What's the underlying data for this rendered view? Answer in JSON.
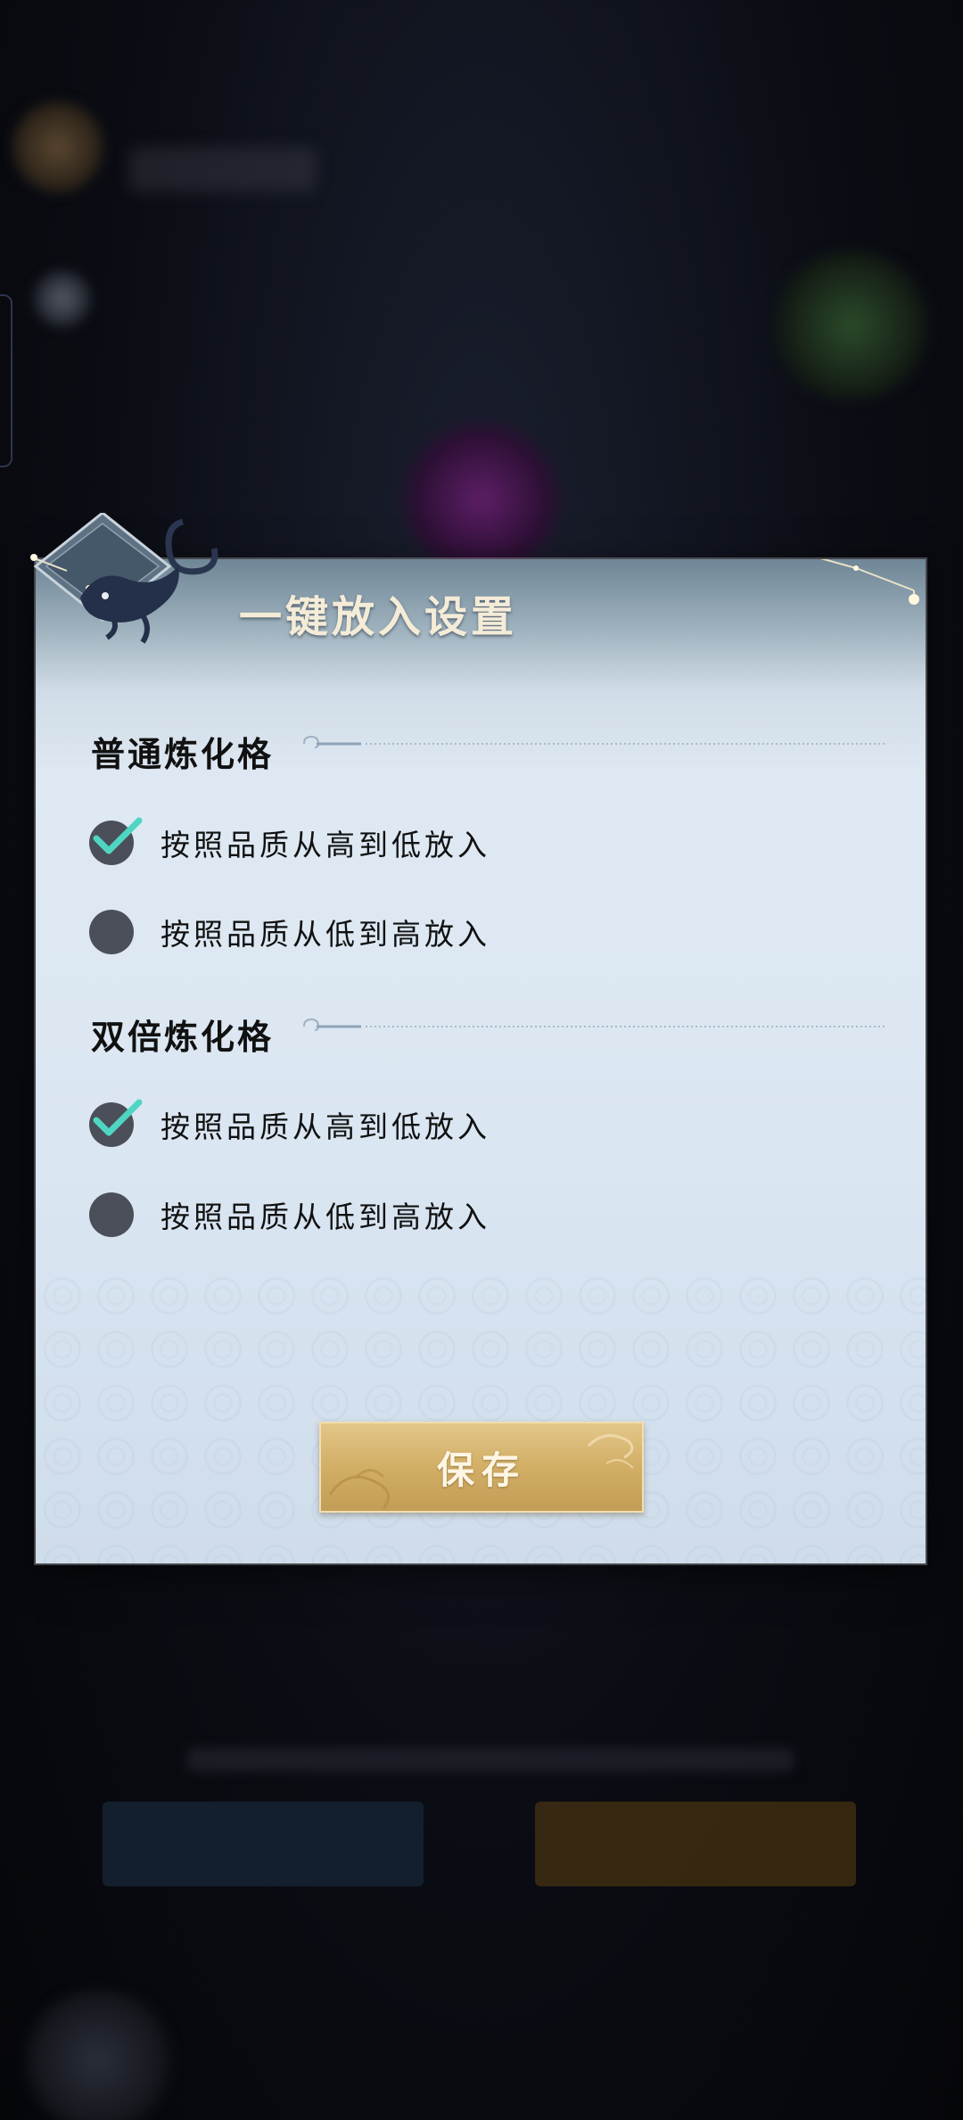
{
  "dialog": {
    "title": "一键放入设置",
    "sections": [
      {
        "title": "普通炼化格",
        "options": [
          {
            "label": "按照品质从高到低放入",
            "checked": true
          },
          {
            "label": "按照品质从低到高放入",
            "checked": false
          }
        ]
      },
      {
        "title": "双倍炼化格",
        "options": [
          {
            "label": "按照品质从高到低放入",
            "checked": true
          },
          {
            "label": "按照品质从低到高放入",
            "checked": false
          }
        ]
      }
    ],
    "save_label": "保存"
  },
  "colors": {
    "accent_check": "#4fd6c2",
    "radio_fill": "#4b4f59",
    "button_gold": "#d2ae66",
    "title_text": "#f4ecd7"
  },
  "icons": {
    "check": "checkmark-icon",
    "emblem": "fox-emblem-icon"
  }
}
